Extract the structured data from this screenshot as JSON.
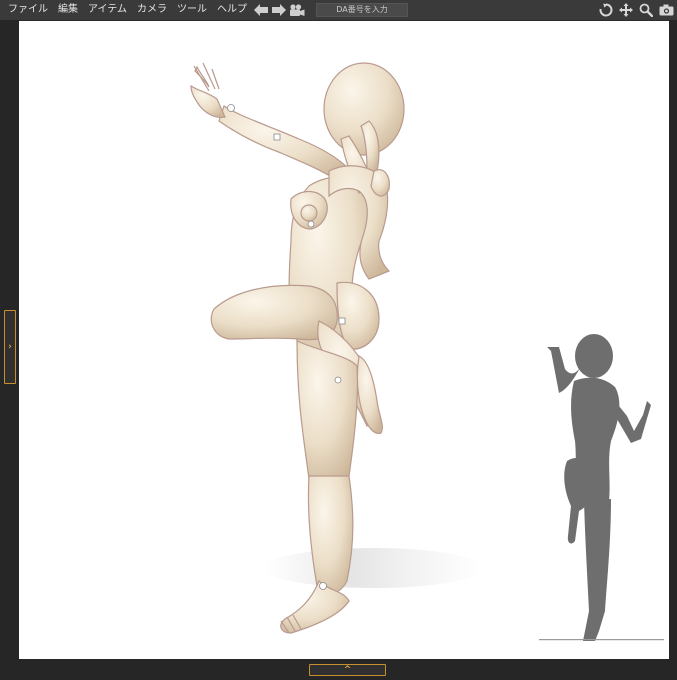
{
  "menu": {
    "file": "ファイル",
    "edit": "編集",
    "item": "アイテム",
    "camera": "カメラ",
    "tool": "ツール",
    "help": "ヘルプ"
  },
  "toolbar": {
    "back_icon": "arrow-left-icon",
    "forward_icon": "arrow-right-icon",
    "camera_icon": "movie-camera-icon",
    "da_placeholder": "DA番号を入力",
    "right_icons": [
      "rotate-icon",
      "move-icon",
      "zoom-icon",
      "screenshot-icon"
    ]
  },
  "panels": {
    "left_toggle": "›",
    "bottom_toggle": "^"
  },
  "colors": {
    "accent": "#c8902c",
    "menubar": "#3a3a3a",
    "frame": "#262626",
    "viewport": "#ffffff",
    "mannequin": "#efe4d2",
    "silhouette": "#6e6e6e"
  }
}
